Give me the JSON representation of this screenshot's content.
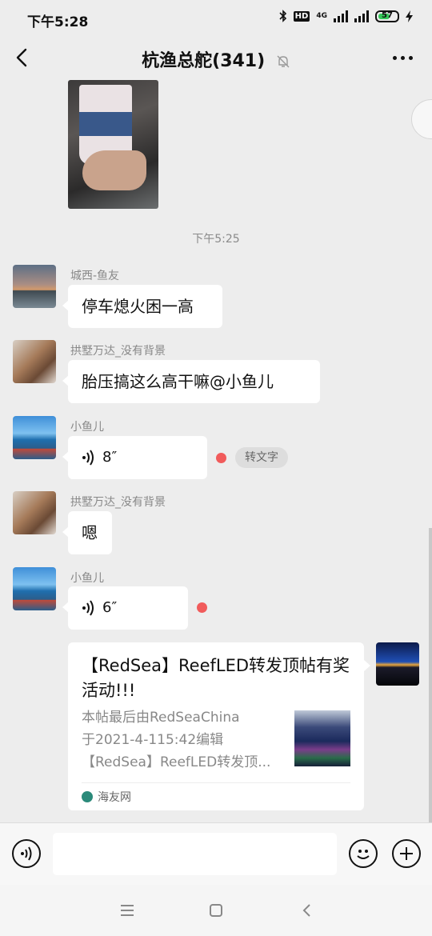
{
  "status_bar": {
    "time": "下午5:28",
    "network": "4G",
    "battery_level": "57"
  },
  "header": {
    "title": "杭渔总舵(341)",
    "back_icon": "chevron-left-icon",
    "muted_icon": "bell-off-icon",
    "more_icon": "more-dots-icon"
  },
  "chat": {
    "timestamp": "下午5:25",
    "messages": [
      {
        "sender": "城西-鱼友",
        "text": "停车熄火困一高"
      },
      {
        "sender": "拱墅万达_没有背景",
        "text": "胎压搞这么高干嘛@小鱼儿"
      },
      {
        "sender": "小鱼儿",
        "voice_duration": "8″",
        "transcribe_label": "转文字"
      },
      {
        "sender": "拱墅万达_没有背景",
        "text": "嗯"
      },
      {
        "sender": "小鱼儿",
        "voice_duration": "6″"
      }
    ],
    "link_card": {
      "title": "【RedSea】ReefLED转发顶帖有奖活动!!!",
      "desc_lines": [
        "本帖最后由RedSeaChina",
        "于2021-4-115:42编辑",
        "【RedSea】ReefLED转发顶..."
      ],
      "source": "海友网"
    }
  },
  "input_bar": {
    "voice_icon": "voice-icon",
    "emoji_icon": "emoji-icon",
    "plus_icon": "plus-icon",
    "placeholder": ""
  },
  "colors": {
    "background": "#ededed",
    "bubble": "#ffffff",
    "unread_dot": "#f15b5b"
  }
}
